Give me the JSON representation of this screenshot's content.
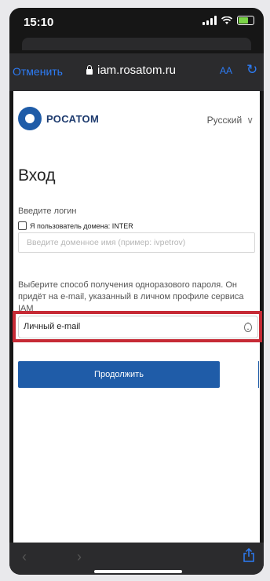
{
  "status_bar": {
    "time": "15:10"
  },
  "browser": {
    "cancel_label": "Отменить",
    "url": "iam.rosatom.ru",
    "text_size_label": "AA"
  },
  "brand": {
    "name": "РОСАТОМ"
  },
  "language": {
    "selected": "Русский"
  },
  "form": {
    "title": "Вход",
    "login_label": "Введите логин",
    "domain_checkbox_label": "Я пользователь домена: INTER",
    "domain_placeholder": "Введите доменное имя (пример: ivpetrov)",
    "otp_instruction": "Выберите способ получения одноразового пароля. Он придёт на e-mail, указанный в личном профиле сервиса IAM",
    "otp_method_selected": "Личный e-mail",
    "continue_label": "Продолжить"
  },
  "colors": {
    "brand_blue": "#1f5ca8",
    "ios_link_blue": "#2d7cf6",
    "highlight_red": "#c62a35"
  }
}
